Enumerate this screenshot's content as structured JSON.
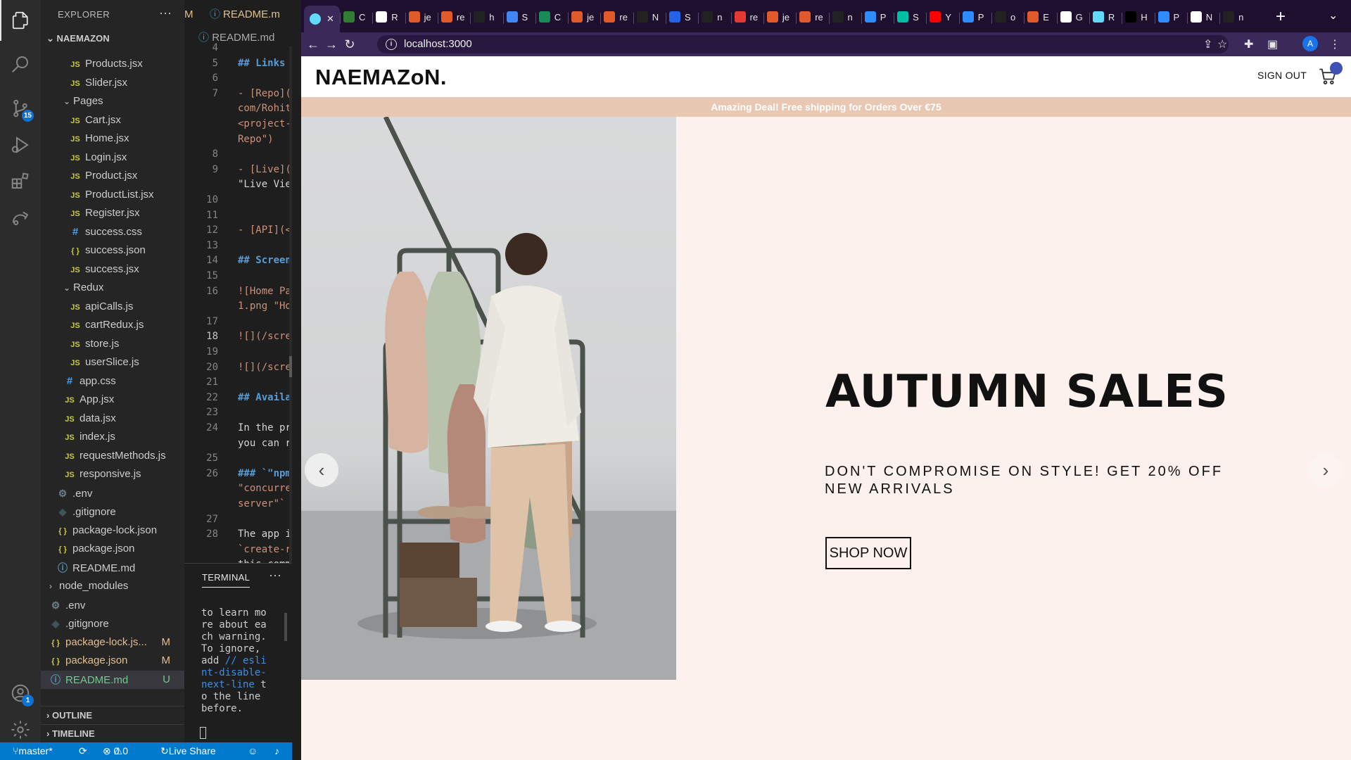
{
  "vscode": {
    "explorer_title": "EXPLORER",
    "root": "NAEMAZON",
    "tree": [
      {
        "label": "Products.jsx",
        "kind": "js",
        "depth": 3
      },
      {
        "label": "Slider.jsx",
        "kind": "js",
        "depth": 3
      },
      {
        "label": "Pages",
        "kind": "folder",
        "depth": 2
      },
      {
        "label": "Cart.jsx",
        "kind": "js",
        "depth": 3
      },
      {
        "label": "Home.jsx",
        "kind": "js",
        "depth": 3
      },
      {
        "label": "Login.jsx",
        "kind": "js",
        "depth": 3
      },
      {
        "label": "Product.jsx",
        "kind": "js",
        "depth": 3
      },
      {
        "label": "ProductList.jsx",
        "kind": "js",
        "depth": 3
      },
      {
        "label": "Register.jsx",
        "kind": "js",
        "depth": 3
      },
      {
        "label": "success.css",
        "kind": "css",
        "depth": 3
      },
      {
        "label": "success.json",
        "kind": "json",
        "depth": 3
      },
      {
        "label": "success.jsx",
        "kind": "js",
        "depth": 3
      },
      {
        "label": "Redux",
        "kind": "folder",
        "depth": 2
      },
      {
        "label": "apiCalls.js",
        "kind": "js",
        "depth": 3
      },
      {
        "label": "cartRedux.js",
        "kind": "js",
        "depth": 3
      },
      {
        "label": "store.js",
        "kind": "js",
        "depth": 3
      },
      {
        "label": "userSlice.js",
        "kind": "js",
        "depth": 3
      },
      {
        "label": "app.css",
        "kind": "css",
        "depth": 2
      },
      {
        "label": "App.jsx",
        "kind": "js",
        "depth": 2
      },
      {
        "label": "data.jsx",
        "kind": "js",
        "depth": 2
      },
      {
        "label": "index.js",
        "kind": "js",
        "depth": 2
      },
      {
        "label": "requestMethods.js",
        "kind": "js",
        "depth": 2
      },
      {
        "label": "responsive.js",
        "kind": "js",
        "depth": 2
      },
      {
        "label": ".env",
        "kind": "gear",
        "depth": 1
      },
      {
        "label": ".gitignore",
        "kind": "git",
        "depth": 1
      },
      {
        "label": "package-lock.json",
        "kind": "json",
        "depth": 1
      },
      {
        "label": "package.json",
        "kind": "json",
        "depth": 1
      },
      {
        "label": "README.md",
        "kind": "info",
        "depth": 1
      },
      {
        "label": "node_modules",
        "kind": "folder-closed",
        "depth": 0
      },
      {
        "label": ".env",
        "kind": "gear",
        "depth": 0
      },
      {
        "label": ".gitignore",
        "kind": "git",
        "depth": 0
      },
      {
        "label": "package-lock.js...",
        "kind": "json",
        "depth": 0,
        "status": "M"
      },
      {
        "label": "package.json",
        "kind": "json",
        "depth": 0,
        "status": "M"
      },
      {
        "label": "README.md",
        "kind": "info",
        "depth": 0,
        "status": "U"
      }
    ],
    "outline": "OUTLINE",
    "timeline": "TIMELINE",
    "editor_tab": "README.m",
    "editor_tab_prev": "M",
    "breadcrumb": "README.md",
    "code": [
      {
        "ln": "4",
        "text": "",
        "style": "p"
      },
      {
        "ln": "5",
        "text": "## Links",
        "style": "h"
      },
      {
        "ln": "6",
        "text": "",
        "style": "p"
      },
      {
        "ln": "7",
        "text": "- [Repo](",
        "style": "l"
      },
      {
        "ln": "",
        "text": "com/Rohit",
        "style": "l"
      },
      {
        "ln": "",
        "text": "<project-",
        "style": "l"
      },
      {
        "ln": "",
        "text": "Repo\")",
        "style": "l"
      },
      {
        "ln": "8",
        "text": "",
        "style": "p"
      },
      {
        "ln": "9",
        "text": "- [Live](",
        "style": "l"
      },
      {
        "ln": "",
        "text": "\"Live Vie",
        "style": "p"
      },
      {
        "ln": "10",
        "text": "",
        "style": "p"
      },
      {
        "ln": "11",
        "text": "",
        "style": "p"
      },
      {
        "ln": "12",
        "text": "- [API](<",
        "style": "l"
      },
      {
        "ln": "13",
        "text": "",
        "style": "p"
      },
      {
        "ln": "14",
        "text": "## Screen",
        "style": "h"
      },
      {
        "ln": "15",
        "text": "",
        "style": "p"
      },
      {
        "ln": "16",
        "text": "![Home Pa",
        "style": "l"
      },
      {
        "ln": "",
        "text": "1.png \"Ho",
        "style": "l"
      },
      {
        "ln": "17",
        "text": "",
        "style": "p"
      },
      {
        "ln": "18",
        "text": "![](/scre",
        "style": "l"
      },
      {
        "ln": "19",
        "text": "",
        "style": "p"
      },
      {
        "ln": "20",
        "text": "![](/scre",
        "style": "l"
      },
      {
        "ln": "21",
        "text": "",
        "style": "p"
      },
      {
        "ln": "22",
        "text": "## Availa",
        "style": "h"
      },
      {
        "ln": "23",
        "text": "",
        "style": "p"
      },
      {
        "ln": "24",
        "text": "In the pr",
        "style": "p"
      },
      {
        "ln": "",
        "text": "you can r",
        "style": "p"
      },
      {
        "ln": "25",
        "text": "",
        "style": "p"
      },
      {
        "ln": "26",
        "text": "### `\"npm",
        "style": "h"
      },
      {
        "ln": "",
        "text": "\"concurre",
        "style": "l"
      },
      {
        "ln": "",
        "text": "server\"` ",
        "style": "l"
      },
      {
        "ln": "27",
        "text": "",
        "style": "p"
      },
      {
        "ln": "28",
        "text": "The app i",
        "style": "p"
      },
      {
        "ln": "",
        "text": "`create-r",
        "style": "l"
      },
      {
        "ln": "",
        "text": "this comm",
        "style": "p"
      }
    ],
    "terminal_title": "TERMINAL",
    "terminal_text_a": "to learn more about each warning. To ignore, add ",
    "terminal_text_b": "// eslint-disable-next-line",
    "terminal_text_c": " to the line before.",
    "status": {
      "branch": "master*",
      "errors": "0",
      "warnings": "0",
      "live_share": "Live Share"
    },
    "badges": {
      "scm": "15",
      "accounts": "1"
    }
  },
  "browser": {
    "url": "localhost:3000",
    "tabs": [
      {
        "label": "C",
        "color": "#2e7d32"
      },
      {
        "label": "R",
        "color": "#ffffff"
      },
      {
        "label": "je",
        "color": "#e05a2b"
      },
      {
        "label": "re",
        "color": "#e05a2b"
      },
      {
        "label": "h",
        "color": "#222222"
      },
      {
        "label": "S",
        "color": "#4285f4"
      },
      {
        "label": "C",
        "color": "#1b8a5a"
      },
      {
        "label": "je",
        "color": "#e05a2b"
      },
      {
        "label": "re",
        "color": "#e05a2b"
      },
      {
        "label": "N",
        "color": "#222222"
      },
      {
        "label": "S",
        "color": "#2563eb"
      },
      {
        "label": "n",
        "color": "#222222"
      },
      {
        "label": "re",
        "color": "#e53935"
      },
      {
        "label": "je",
        "color": "#e05a2b"
      },
      {
        "label": "re",
        "color": "#e05a2b"
      },
      {
        "label": "n",
        "color": "#222222"
      },
      {
        "label": "P",
        "color": "#2d8cff"
      },
      {
        "label": "S",
        "color": "#00bfa5"
      },
      {
        "label": "Y",
        "color": "#ff0000"
      },
      {
        "label": "P",
        "color": "#2d8cff"
      },
      {
        "label": "o",
        "color": "#222222"
      },
      {
        "label": "E",
        "color": "#e05a2b"
      },
      {
        "label": "G",
        "color": "#ffffff"
      },
      {
        "label": "R",
        "color": "#61dafb"
      },
      {
        "label": "H",
        "color": "#000000"
      },
      {
        "label": "P",
        "color": "#2d8cff"
      },
      {
        "label": "N",
        "color": "#ffffff"
      },
      {
        "label": "n",
        "color": "#222222"
      }
    ]
  },
  "site": {
    "logo": "NAEMAZoN.",
    "sign_out": "SIGN OUT",
    "announcement": "Amazing Deal! Free shipping for Orders Over €75",
    "hero_title": "AUTUMN SALES",
    "hero_desc": "DON'T COMPROMISE ON STYLE! GET 20% OFF NEW ARRIVALS",
    "cta": "SHOP NOW",
    "prev_icon": "‹",
    "next_icon": "›"
  },
  "colors": {
    "vscode_accent": "#007acc",
    "chrome_frame": "#1f0f2e",
    "page_bg": "#fcf1ed",
    "announce_bg": "#e9c8b3"
  }
}
